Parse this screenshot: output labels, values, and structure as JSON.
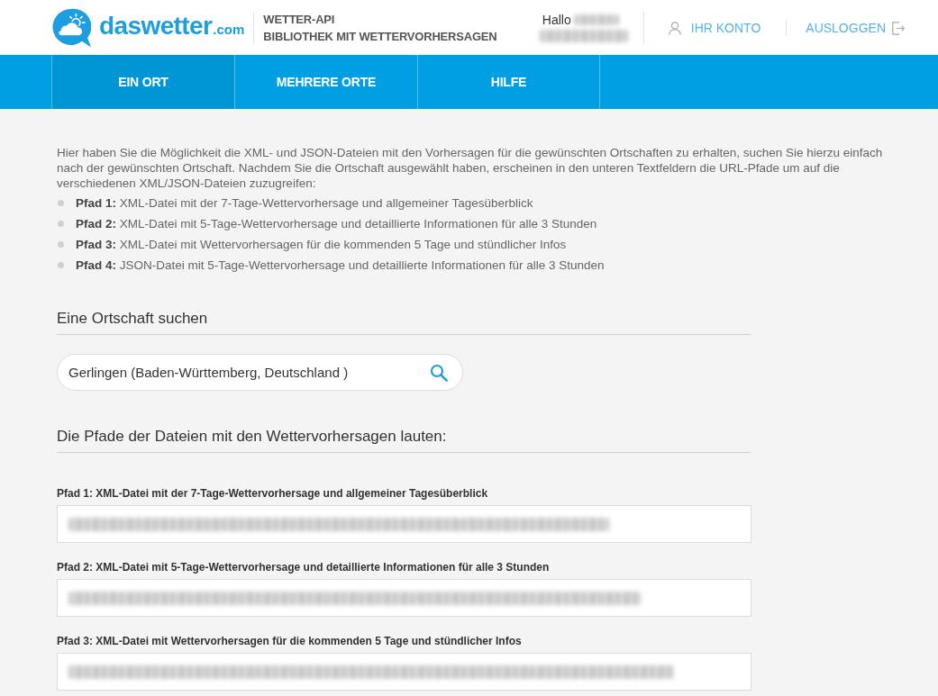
{
  "header": {
    "logo_name": "daswetter",
    "logo_suffix": ".com",
    "title": "WETTER-API",
    "subtitle": "BIBLIOTHEK MIT WETTERVORHERSAGEN",
    "greeting": "Hallo",
    "user_name_blurred": true,
    "account_link": "IHR KONTO",
    "logout_link": "AUSLOGGEN"
  },
  "tabs": [
    {
      "label": "EIN ORT",
      "selected": true
    },
    {
      "label": "MEHRERE ORTE",
      "selected": false
    },
    {
      "label": "HILFE",
      "selected": false
    }
  ],
  "intro": {
    "text": "Hier haben Sie die Möglichkeit die XML- und JSON-Dateien mit den Vorhersagen für die gewünschten Ortschaften zu erhalten, suchen Sie hierzu einfach nach der gewünschten Ortschaft. Nachdem Sie die Ortschaft ausgewählt haben, erscheinen in den unteren Textfeldern die URL-Pfade um auf die verschiedenen XML/JSON-Dateien zuzugreifen:",
    "items": [
      "**Pfad 1:** XML-Datei mit der 7-Tage-Wettervorhersage und allgemeiner Tagesüberblick",
      "**Pfad 2:** XML-Datei mit 5-Tage-Wettervorhersage und detaillierte Informationen für alle 3 Stunden",
      "**Pfad 3:** XML-Datei mit Wettervorhersagen für die kommenden 5 Tage und stündlicher Infos",
      "**Pfad 4:** JSON-Datei mit 5-Tage-Wettervorhersage und detaillierte Informationen für alle 3 Stunden"
    ]
  },
  "search": {
    "heading": "Eine Ortschaft suchen",
    "value": "Gerlingen (Baden-Württemberg, Deutschland )"
  },
  "paths": {
    "heading": "Die Pfade der Dateien mit den Wettervorhersagen lauten:",
    "fields": [
      {
        "label": "Pfad 1: XML-Datei mit der 7-Tage-Wettervorhersage und allgemeiner Tagesüberblick",
        "value_blurred": true
      },
      {
        "label": "Pfad 2: XML-Datei mit 5-Tage-Wettervorhersage und detaillierte Informationen für alle 3 Stunden",
        "value_blurred": true
      },
      {
        "label": "Pfad 3: XML-Datei mit Wettervorhersagen für die kommenden 5 Tage und stündlicher Infos",
        "value_blurred": true
      }
    ]
  }
}
